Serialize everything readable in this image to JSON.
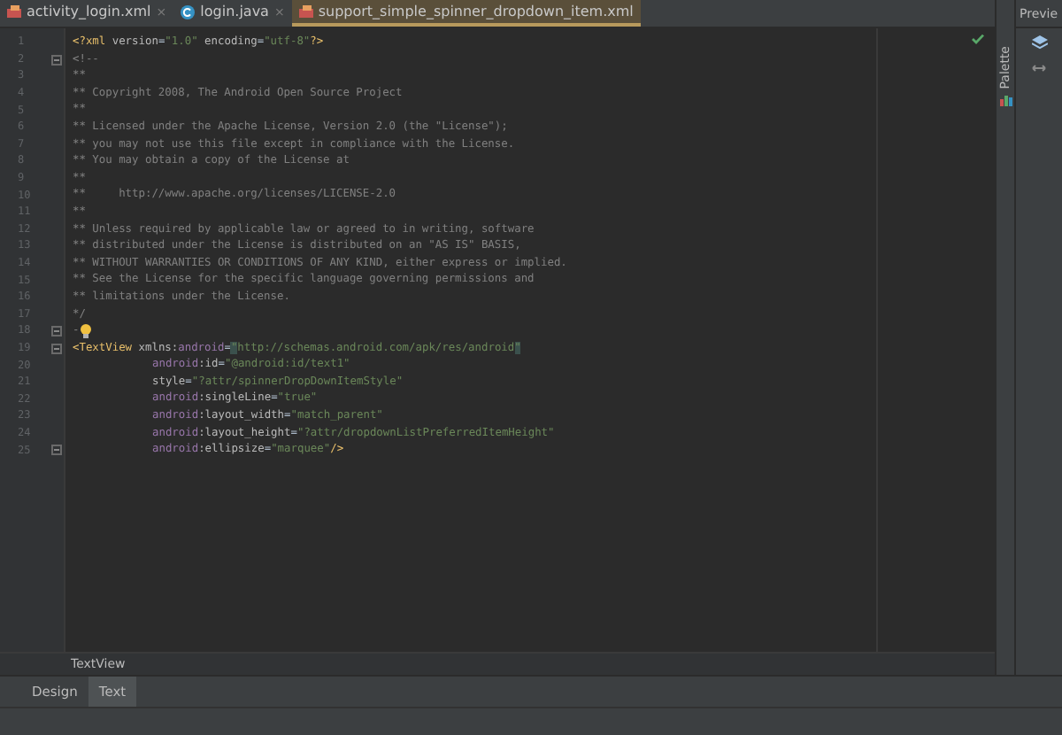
{
  "tabs": [
    {
      "label": "activity_login.xml",
      "kind": "xml",
      "selected": false,
      "close": "×"
    },
    {
      "label": "login.java",
      "kind": "java",
      "selected": false,
      "close": "×"
    },
    {
      "label": "support_simple_spinner_dropdown_item.xml",
      "kind": "xml",
      "selected": true
    }
  ],
  "editor": {
    "lines": [
      {
        "number": "1",
        "fold": false,
        "indent": false,
        "tokens": [
          {
            "kind": "tag",
            "text": "<?xml "
          },
          {
            "kind": "attr",
            "text": "version"
          },
          {
            "kind": "plain",
            "text": "="
          },
          {
            "kind": "value",
            "text": "\"1.0\""
          },
          {
            "kind": "attr",
            "text": " encoding"
          },
          {
            "kind": "plain",
            "text": "="
          },
          {
            "kind": "value",
            "text": "\"utf-8\""
          },
          {
            "kind": "tag",
            "text": "?>"
          }
        ]
      },
      {
        "number": "2",
        "fold": true,
        "indent": false,
        "tokens": [
          {
            "kind": "comment",
            "text": "<!--"
          }
        ]
      },
      {
        "number": "3",
        "fold": false,
        "indent": false,
        "tokens": [
          {
            "kind": "comment",
            "text": "**"
          }
        ]
      },
      {
        "number": "4",
        "fold": false,
        "indent": false,
        "tokens": [
          {
            "kind": "comment",
            "text": "** Copyright 2008, The Android Open Source Project"
          }
        ]
      },
      {
        "number": "5",
        "fold": false,
        "indent": false,
        "tokens": [
          {
            "kind": "comment",
            "text": "**"
          }
        ]
      },
      {
        "number": "6",
        "fold": false,
        "indent": false,
        "tokens": [
          {
            "kind": "comment",
            "text": "** Licensed under the Apache License, Version 2.0 (the \"License\");"
          }
        ]
      },
      {
        "number": "7",
        "fold": false,
        "indent": false,
        "tokens": [
          {
            "kind": "comment",
            "text": "** you may not use this file except in compliance with the License."
          }
        ]
      },
      {
        "number": "8",
        "fold": false,
        "indent": false,
        "tokens": [
          {
            "kind": "comment",
            "text": "** You may obtain a copy of the License at"
          }
        ]
      },
      {
        "number": "9",
        "fold": false,
        "indent": false,
        "tokens": [
          {
            "kind": "comment",
            "text": "**"
          }
        ]
      },
      {
        "number": "10",
        "fold": false,
        "indent": false,
        "tokens": [
          {
            "kind": "comment",
            "text": "**     http://www.apache.org/licenses/LICENSE-2.0"
          }
        ]
      },
      {
        "number": "11",
        "fold": false,
        "indent": false,
        "tokens": [
          {
            "kind": "comment",
            "text": "**"
          }
        ]
      },
      {
        "number": "12",
        "fold": false,
        "indent": false,
        "tokens": [
          {
            "kind": "comment",
            "text": "** Unless required by applicable law or agreed to in writing, software"
          }
        ]
      },
      {
        "number": "13",
        "fold": false,
        "indent": false,
        "tokens": [
          {
            "kind": "comment",
            "text": "** distributed under the License is distributed on an \"AS IS\" BASIS,"
          }
        ]
      },
      {
        "number": "14",
        "fold": false,
        "indent": false,
        "tokens": [
          {
            "kind": "comment",
            "text": "** WITHOUT WARRANTIES OR CONDITIONS OF ANY KIND, either express or implied."
          }
        ]
      },
      {
        "number": "15",
        "fold": false,
        "indent": false,
        "tokens": [
          {
            "kind": "comment",
            "text": "** See the License for the specific language governing permissions and"
          }
        ]
      },
      {
        "number": "16",
        "fold": false,
        "indent": false,
        "tokens": [
          {
            "kind": "comment",
            "text": "** limitations under the License."
          }
        ]
      },
      {
        "number": "17",
        "fold": false,
        "indent": false,
        "tokens": [
          {
            "kind": "comment",
            "text": "*/"
          }
        ]
      },
      {
        "number": "18",
        "fold": true,
        "indent": false,
        "bulb": true,
        "tokens": [
          {
            "kind": "comment",
            "text": "-"
          }
        ]
      },
      {
        "number": "19",
        "fold": true,
        "indent": false,
        "tokens": [
          {
            "kind": "tag",
            "text": "<TextView "
          },
          {
            "kind": "attr",
            "text": "xmlns:"
          },
          {
            "kind": "ns",
            "text": "android"
          },
          {
            "kind": "plain",
            "text": "="
          },
          {
            "kind": "match",
            "text": "\""
          },
          {
            "kind": "value",
            "text": "http://schemas.android.com/apk/res/android"
          },
          {
            "kind": "match",
            "text": "\""
          }
        ]
      },
      {
        "number": "20",
        "fold": false,
        "indent": true,
        "tokens": [
          {
            "kind": "ns",
            "text": "android"
          },
          {
            "kind": "attr",
            "text": ":id"
          },
          {
            "kind": "plain",
            "text": "="
          },
          {
            "kind": "value",
            "text": "\"@android:id/text1\""
          }
        ]
      },
      {
        "number": "21",
        "fold": false,
        "indent": true,
        "tokens": [
          {
            "kind": "attr",
            "text": "style"
          },
          {
            "kind": "plain",
            "text": "="
          },
          {
            "kind": "value",
            "text": "\"?attr/spinnerDropDownItemStyle\""
          }
        ]
      },
      {
        "number": "22",
        "fold": false,
        "indent": true,
        "tokens": [
          {
            "kind": "ns",
            "text": "android"
          },
          {
            "kind": "attr",
            "text": ":singleLine"
          },
          {
            "kind": "plain",
            "text": "="
          },
          {
            "kind": "value",
            "text": "\"true\""
          }
        ]
      },
      {
        "number": "23",
        "fold": false,
        "indent": true,
        "tokens": [
          {
            "kind": "ns",
            "text": "android"
          },
          {
            "kind": "attr",
            "text": ":layout_width"
          },
          {
            "kind": "plain",
            "text": "="
          },
          {
            "kind": "value",
            "text": "\"match_parent\""
          }
        ]
      },
      {
        "number": "24",
        "fold": false,
        "indent": true,
        "tokens": [
          {
            "kind": "ns",
            "text": "android"
          },
          {
            "kind": "attr",
            "text": ":layout_height"
          },
          {
            "kind": "plain",
            "text": "="
          },
          {
            "kind": "value",
            "text": "\"?attr/dropdownListPreferredItemHeight\""
          }
        ]
      },
      {
        "number": "25",
        "fold": true,
        "indent": true,
        "tokens": [
          {
            "kind": "ns",
            "text": "android"
          },
          {
            "kind": "attr",
            "text": ":ellipsize"
          },
          {
            "kind": "plain",
            "text": "="
          },
          {
            "kind": "value",
            "text": "\"marquee\""
          },
          {
            "kind": "tag",
            "text": "/>"
          }
        ]
      }
    ]
  },
  "palette_label": "Palette",
  "preview_title": "Previe",
  "breadcrumb": "TextView",
  "bottom_tabs": [
    {
      "label": "Design",
      "selected": false
    },
    {
      "label": "Text",
      "selected": true
    }
  ]
}
